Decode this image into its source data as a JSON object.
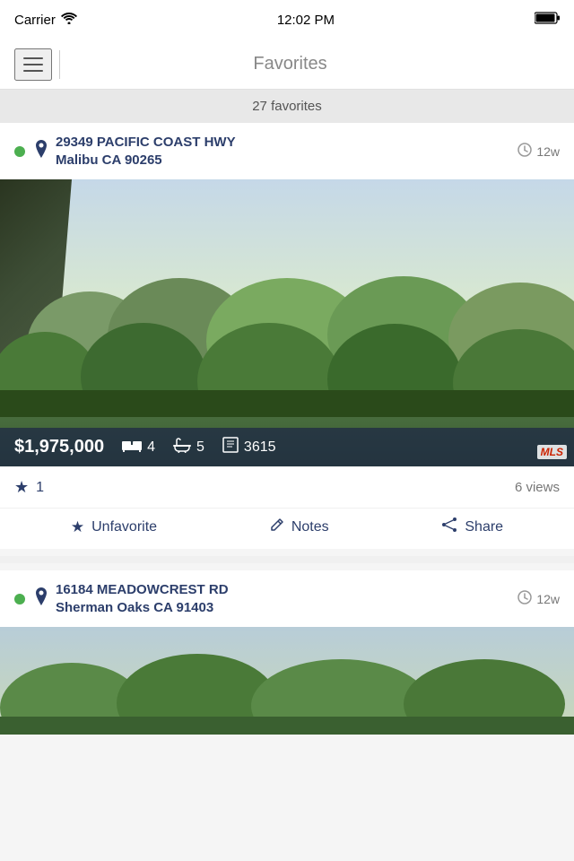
{
  "statusBar": {
    "carrier": "Carrier",
    "time": "12:02 PM"
  },
  "navBar": {
    "title": "Favorites"
  },
  "countBar": {
    "label": "27 favorites"
  },
  "listings": [
    {
      "id": "listing-1",
      "addressLine1": "29349 PACIFIC COAST HWY",
      "addressLine2": "Malibu CA 90265",
      "time": "12w",
      "price": "$1,975,000",
      "beds": "4",
      "baths": "5",
      "sqft": "3615",
      "starCount": "1",
      "views": "6 views",
      "actions": {
        "unfavorite": "Unfavorite",
        "notes": "Notes",
        "share": "Share"
      }
    },
    {
      "id": "listing-2",
      "addressLine1": "16184 MEADOWCREST RD",
      "addressLine2": "Sherman Oaks CA 91403",
      "time": "12w"
    }
  ]
}
